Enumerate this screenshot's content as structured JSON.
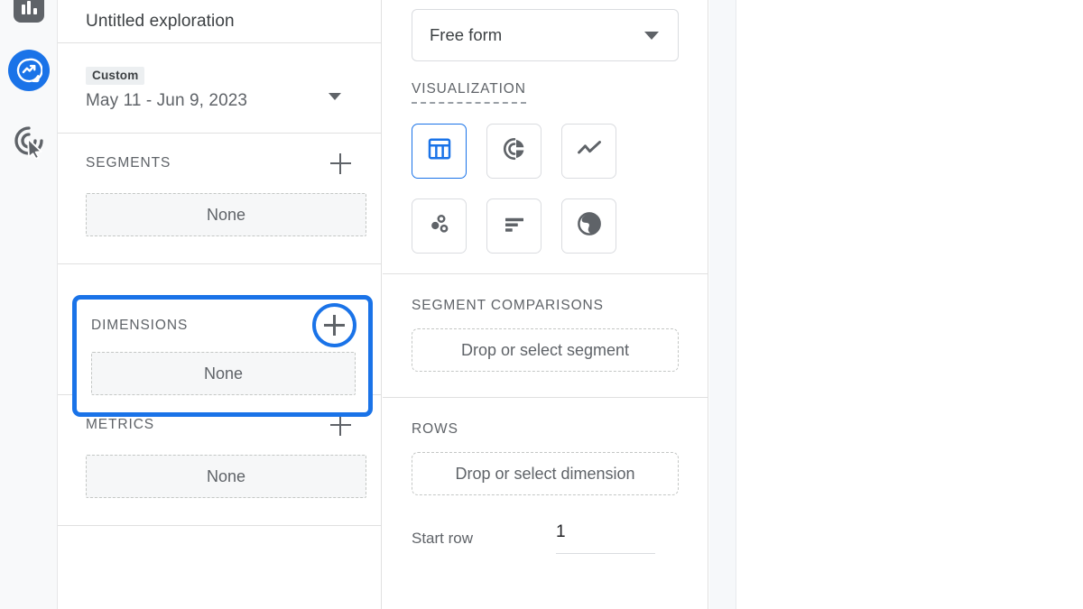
{
  "app": {
    "accent_color": "#1a73e8",
    "highlight_color": "#1a73e8",
    "text_color": "#5f6368",
    "panel_border_color": "#e0e0e0"
  },
  "rail": {
    "items": [
      {
        "name": "reports",
        "icon": "bar-chart-icon",
        "label": "Reports",
        "active": false
      },
      {
        "name": "explore",
        "icon": "explore-icon",
        "label": "Explore",
        "active": true
      },
      {
        "name": "advertising",
        "icon": "advertising-target-cursor-icon",
        "label": "Advertising",
        "active": false
      }
    ]
  },
  "variables": {
    "title": "Untitled exploration",
    "date_range": {
      "chip": "Custom",
      "value": "May 11 - Jun 9, 2023",
      "caret_icon": "chevron-down-icon"
    },
    "sections": [
      {
        "key": "segments",
        "label": "SEGMENTS",
        "slot_value": "None",
        "add_icon": "plus-icon",
        "highlighted": false
      },
      {
        "key": "dimensions",
        "label": "DIMENSIONS",
        "slot_value": "None",
        "add_icon": "plus-icon",
        "highlighted": true
      },
      {
        "key": "metrics",
        "label": "METRICS",
        "slot_value": "None",
        "add_icon": "plus-icon",
        "highlighted": false
      }
    ]
  },
  "settings": {
    "technique": {
      "value": "Free form",
      "caret_icon": "chevron-down-icon"
    },
    "visualization": {
      "label": "VISUALIZATION",
      "options": [
        {
          "name": "free-form-table",
          "icon": "table-icon",
          "selected": true
        },
        {
          "name": "donut-chart",
          "icon": "donut-chart-icon",
          "selected": false
        },
        {
          "name": "line-chart",
          "icon": "line-chart-icon",
          "selected": false
        },
        {
          "name": "scatter-plot",
          "icon": "scatter-plot-icon",
          "selected": false
        },
        {
          "name": "bar-chart",
          "icon": "bar-chart-icon",
          "selected": false
        },
        {
          "name": "geo-map",
          "icon": "globe-icon",
          "selected": false
        }
      ]
    },
    "segment_comparisons": {
      "label": "SEGMENT COMPARISONS",
      "drop_text": "Drop or select segment"
    },
    "rows": {
      "label": "ROWS",
      "drop_text": "Drop or select dimension",
      "start_row_label": "Start row",
      "start_row_value": "1"
    }
  }
}
